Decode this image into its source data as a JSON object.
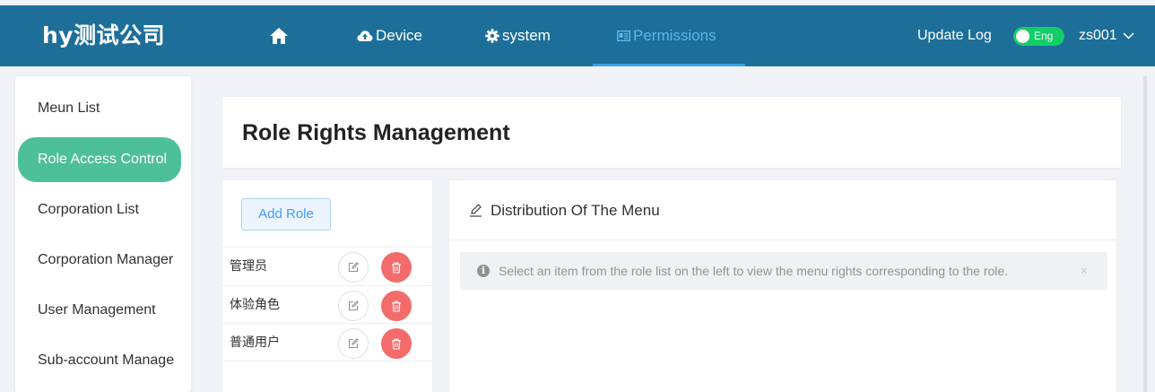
{
  "header": {
    "brand": "hy测试公司",
    "nav": {
      "home_icon": "home-icon",
      "device_label": "Device",
      "device_icon": "cloud-upload-icon",
      "system_label": "system",
      "system_icon": "gear-icon",
      "permissions_label": "Permissions",
      "permissions_icon": "id-card-icon"
    },
    "update_log": "Update Log",
    "language_toggle": {
      "label": "Eng",
      "on": true
    },
    "user": "zs001",
    "colors": {
      "bar": "#1d6f99",
      "active_nav": "#5fb4e8",
      "toggle": "#13ce66"
    }
  },
  "sidebar": {
    "items": [
      {
        "label": "Meun List",
        "active": false
      },
      {
        "label": "Role Access Control",
        "active": true
      },
      {
        "label": "Corporation List",
        "active": false
      },
      {
        "label": "Corporation Manager",
        "active": false
      },
      {
        "label": "User Management",
        "active": false
      },
      {
        "label": "Sub-account Manage",
        "active": false
      }
    ],
    "active_color": "#4dbf99"
  },
  "main": {
    "title": "Role Rights Management",
    "role_panel": {
      "add_button": "Add Role",
      "roles": [
        {
          "name": "管理员"
        },
        {
          "name": "体验角色"
        },
        {
          "name": "普通用户"
        }
      ]
    },
    "menu_panel": {
      "title": "Distribution Of The Menu",
      "title_icon": "edit-pencil-icon",
      "alert": "Select an item from the role list on the left to view the menu rights corresponding to the role.",
      "alert_close": "×"
    }
  }
}
